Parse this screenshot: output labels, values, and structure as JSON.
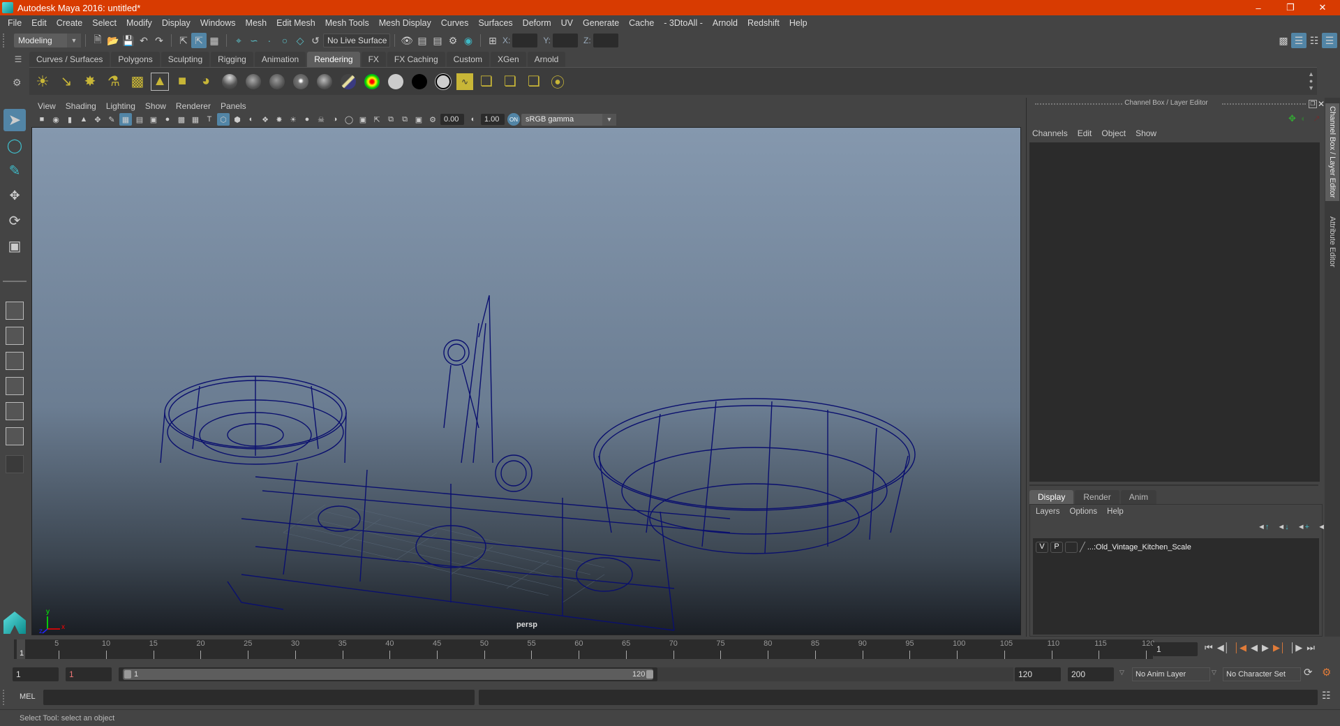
{
  "window": {
    "title": "Autodesk Maya 2016: untitled*",
    "controls": [
      "minimize",
      "restore",
      "close"
    ]
  },
  "menubar": [
    "File",
    "Edit",
    "Create",
    "Select",
    "Modify",
    "Display",
    "Windows",
    "Mesh",
    "Edit Mesh",
    "Mesh Tools",
    "Mesh Display",
    "Curves",
    "Surfaces",
    "Deform",
    "UV",
    "Generate",
    "Cache",
    "- 3DtoAll -",
    "Arnold",
    "Redshift",
    "Help"
  ],
  "statusline": {
    "menuset": "Modeling",
    "live_surface": "No Live Surface",
    "x_label": "X:",
    "y_label": "Y:",
    "z_label": "Z:",
    "x_value": "",
    "y_value": "",
    "z_value": ""
  },
  "shelf": {
    "tabs": [
      "Curves / Surfaces",
      "Polygons",
      "Sculpting",
      "Rigging",
      "Animation",
      "Rendering",
      "FX",
      "FX Caching",
      "Custom",
      "XGen",
      "Arnold"
    ],
    "active_tab": "Rendering",
    "icons": [
      "ambient-light",
      "directional-light",
      "point-light",
      "spot-light",
      "area-light",
      "volume-light",
      "camera-aim",
      "render-settings",
      "blinn-sphere",
      "lambert-sphere",
      "phong-sphere",
      "phongE-sphere",
      "anisotropic-sphere",
      "ramp-shader",
      "layered-shader",
      "surface-shader-white",
      "surface-shader-black",
      "use-background",
      "hypershade",
      "render-view",
      "render-layer-off",
      "render-layer-view",
      "ipr-render"
    ]
  },
  "viewport": {
    "menu": [
      "View",
      "Shading",
      "Lighting",
      "Show",
      "Renderer",
      "Panels"
    ],
    "exposure": "0.00",
    "gamma": "1.00",
    "color_space": "sRGB gamma",
    "camera_label": "persp",
    "axis": {
      "x": "x",
      "y": "y",
      "z": "z"
    },
    "wire_color": "#0a0f6e"
  },
  "channel_box": {
    "title": "Channel Box / Layer Editor",
    "menu": [
      "Channels",
      "Edit",
      "Object",
      "Show"
    ],
    "layer_tabs": [
      "Display",
      "Render",
      "Anim"
    ],
    "active_layer_tab": "Display",
    "layer_menu": [
      "Layers",
      "Options",
      "Help"
    ],
    "layers": [
      {
        "v": "V",
        "p": "P",
        "name": "...:Old_Vintage_Kitchen_Scale"
      }
    ]
  },
  "side_tabs": [
    "Channel Box / Layer Editor",
    "Attribute Editor"
  ],
  "timeline": {
    "ticks": [
      "5",
      "10",
      "15",
      "20",
      "25",
      "30",
      "35",
      "40",
      "45",
      "50",
      "55",
      "60",
      "65",
      "70",
      "75",
      "80",
      "85",
      "90",
      "95",
      "100",
      "105",
      "110",
      "115",
      "120"
    ],
    "current_frame_marker": "1",
    "current_frame": "1",
    "start": 1,
    "end": 120
  },
  "range": {
    "start_time": "1",
    "playback_start": "1",
    "slider_start": "1",
    "slider_end": "120",
    "playback_end": "120",
    "end_time": "200",
    "anim_layer": "No Anim Layer",
    "character_set": "No Character Set"
  },
  "command_line": {
    "label": "MEL",
    "value": "",
    "result": ""
  },
  "help_line": "Select Tool: select an object",
  "colors": {
    "title_bar": "#d83b01",
    "accent": "#5285a6",
    "shelf_icon": "#c8b637"
  }
}
